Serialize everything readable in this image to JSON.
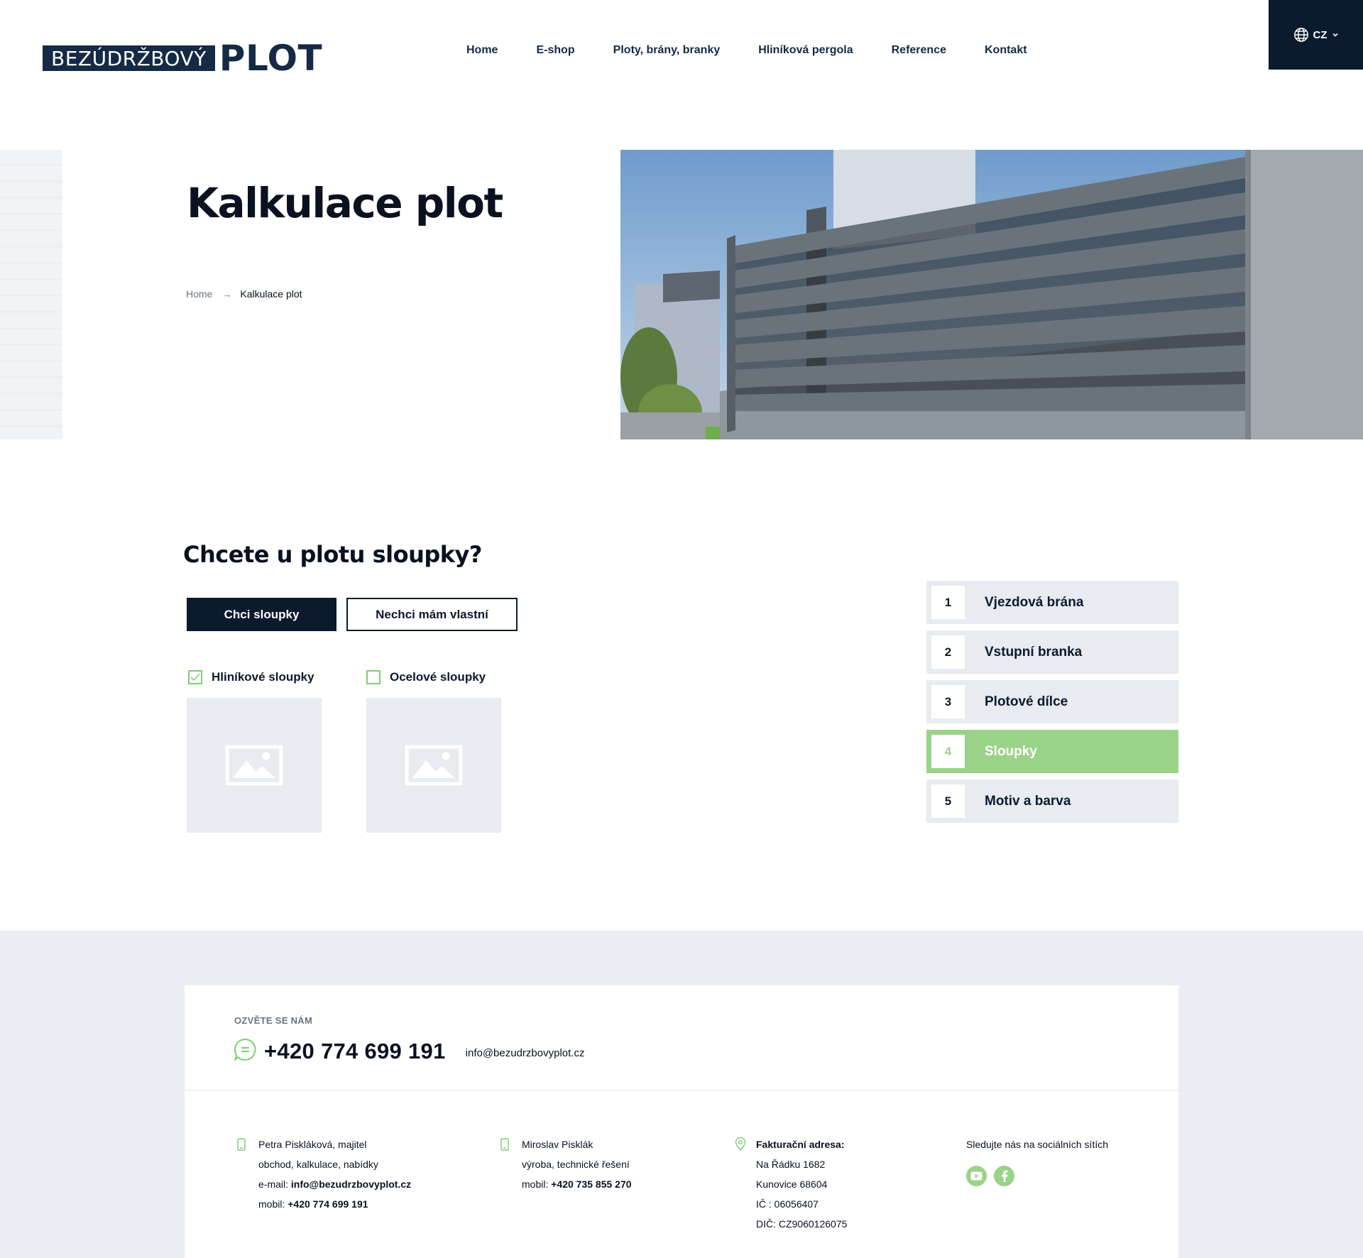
{
  "header": {
    "logo_box_text": "BEZÚDRŽBOVÝ",
    "logo_word": "PLOT",
    "nav": [
      {
        "label": "Home"
      },
      {
        "label": "E-shop"
      },
      {
        "label": "Ploty, brány, branky"
      },
      {
        "label": "Hliníková pergola"
      },
      {
        "label": "Reference"
      },
      {
        "label": "Kontakt"
      }
    ],
    "language": "CZ",
    "icons": {
      "language": "globe-icon",
      "dropdown": "chevron-down-icon"
    }
  },
  "hero": {
    "title": "Kalkulace plot",
    "breadcrumb": {
      "home": "Home",
      "current": "Kalkulace plot"
    }
  },
  "configurator": {
    "question": "Chcete u plotu sloupky?",
    "buttons": {
      "yes": "Chci sloupky",
      "no": "Nechci mám vlastní"
    },
    "options": [
      {
        "label": "Hliníkové sloupky",
        "checked": true
      },
      {
        "label": "Ocelové sloupky",
        "checked": false
      }
    ],
    "steps": [
      {
        "num": "1",
        "label": "Vjezdová brána",
        "active": false
      },
      {
        "num": "2",
        "label": "Vstupní branka",
        "active": false
      },
      {
        "num": "3",
        "label": "Plotové dílce",
        "active": false
      },
      {
        "num": "4",
        "label": "Sloupky",
        "active": true
      },
      {
        "num": "5",
        "label": "Motiv a barva",
        "active": false
      }
    ]
  },
  "footer": {
    "kicker": "OZVĚTE SE NÁM",
    "phone": "+420 774 699 191",
    "email": "info@bezudrzbovyplot.cz",
    "col1": {
      "line1": "Petra Piskláková, majitel",
      "line2": "obchod, kalkulace, nabídky",
      "email_label": "e-mail: ",
      "email": "info@bezudrzbovyplot.cz",
      "mobile_label": "mobil: ",
      "mobile": "+420 774 699 191"
    },
    "col2": {
      "line1": "Miroslav Pisklák",
      "line2": "výroba, technické řešení",
      "mobile_label": "mobil: ",
      "mobile": "+420 735 855 270"
    },
    "col3": {
      "heading": "Fakturační adresa:",
      "street": "Na Řádku 1682",
      "city": "Kunovice 68604",
      "ic": "IČ : 06056407",
      "dic": "DIČ: CZ9060126075"
    },
    "col4": {
      "heading": "Sledujte nás na sociálních sítích",
      "icons": [
        "youtube-icon",
        "facebook-icon"
      ]
    }
  },
  "colors": {
    "navy": "#0c1a2e",
    "accent_green": "#9ad388",
    "light_gray": "#e8ebf0",
    "footer_bg": "#eaedf2"
  }
}
